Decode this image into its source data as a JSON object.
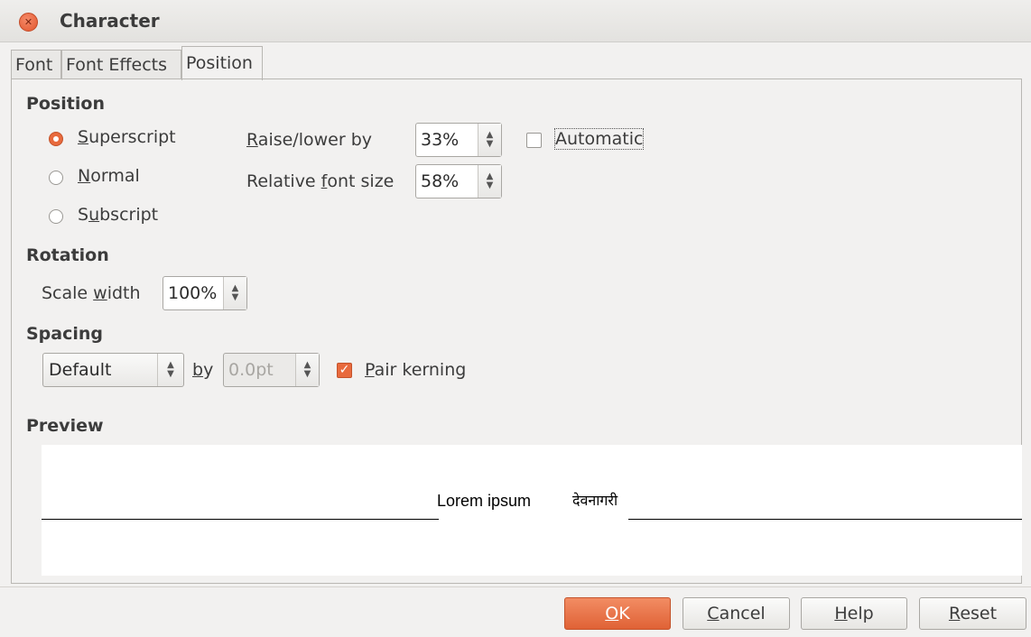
{
  "window": {
    "title": "Character"
  },
  "tabs": [
    {
      "label": "Font"
    },
    {
      "label": "Font Effects"
    },
    {
      "label": "Position"
    }
  ],
  "position": {
    "heading": "Position",
    "superscript_a": "S",
    "superscript_b": "uperscript",
    "normal_a": "N",
    "normal_b": "ormal",
    "subscript_a": "S",
    "subscript_u": "u",
    "subscript_b": "bscript",
    "selected": "Superscript",
    "raise_label_a": "R",
    "raise_label_b": "aise/lower by",
    "raise_value": "33%",
    "relsize_label_a": "Relative ",
    "relsize_label_u": "f",
    "relsize_label_b": "ont size",
    "relsize_value": "58%",
    "automatic_label": "Automatic",
    "automatic_checked": false
  },
  "rotation": {
    "heading": "Rotation",
    "scale_label_a": "Scale ",
    "scale_label_u": "w",
    "scale_label_b": "idth",
    "scale_value": "100%"
  },
  "spacing": {
    "heading": "Spacing",
    "mode_value": "Default",
    "by_u": "b",
    "by_b": "y",
    "by_value": "0.0pt",
    "pair_kerning_u": "P",
    "pair_kerning_b": "air kerning",
    "pair_kerning_checked": true
  },
  "preview": {
    "heading": "Preview",
    "text_latin": "Lorem ipsum",
    "text_devanagari": "देवनागरी"
  },
  "buttons": {
    "ok_u": "O",
    "ok_b": "K",
    "cancel_u": "C",
    "cancel_b": "ancel",
    "help_u": "H",
    "help_b": "elp",
    "reset_u": "R",
    "reset_b": "eset"
  },
  "colors": {
    "accent": "#e86a3d",
    "background": "#f2f1f0"
  }
}
